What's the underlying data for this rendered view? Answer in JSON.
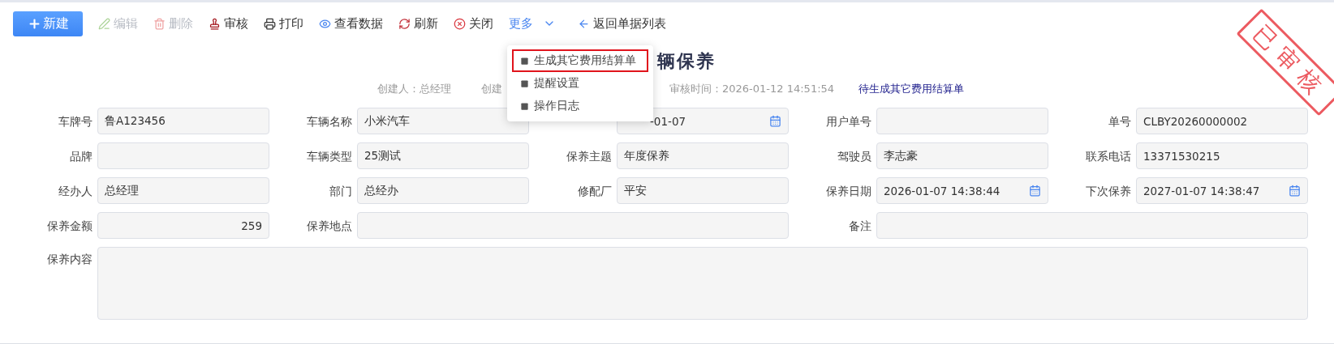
{
  "toolbar": [
    {
      "kind": "new",
      "label": "新建"
    },
    {
      "kind": "edit",
      "label": "编辑",
      "disabled": true
    },
    {
      "kind": "delete",
      "label": "删除",
      "disabled": true
    },
    {
      "kind": "audit",
      "label": "审核",
      "disabled": false
    },
    {
      "kind": "print",
      "label": "打印",
      "disabled": false
    },
    {
      "kind": "view",
      "label": "查看数据",
      "disabled": false
    },
    {
      "kind": "refresh",
      "label": "刷新",
      "disabled": false
    },
    {
      "kind": "close",
      "label": "关闭",
      "disabled": false
    },
    {
      "kind": "dropdown",
      "label": "更多",
      "expanded": true
    },
    {
      "kind": "back",
      "label": "返回单据列表",
      "disabled": false
    }
  ],
  "menu": [
    {
      "label": "生成其它费用结算单",
      "highlighted": true
    },
    {
      "label": "提醒设置",
      "highlighted": false
    },
    {
      "label": "操作日志",
      "highlighted": false
    }
  ],
  "title": "辆保养",
  "meta": [
    {
      "kind": "text",
      "text": "创建人：总经理"
    },
    {
      "kind": "text",
      "text": "创建"
    },
    {
      "kind": "text",
      "text": "审核时间：2026-01-12 14:51:54"
    },
    {
      "kind": "status",
      "text": "待生成其它费用结算单"
    }
  ],
  "stamp": "已审核",
  "fields": [
    {
      "label": "车牌号",
      "value": "鲁A123456",
      "kind": "text"
    },
    {
      "label": "车辆名称",
      "value": "小米汽车",
      "kind": "text"
    },
    {
      "value": "-01-07",
      "kind": "date"
    },
    {
      "label": "用户单号",
      "kind": "text"
    },
    {
      "label": "单号",
      "value": "CLBY20260000002",
      "kind": "text"
    },
    {
      "label": "品牌",
      "kind": "text"
    },
    {
      "label": "车辆类型",
      "value": "25测试",
      "kind": "text"
    },
    {
      "label": "保养主题",
      "value": "年度保养",
      "kind": "text"
    },
    {
      "label": "驾驶员",
      "value": "李志豪",
      "kind": "text"
    },
    {
      "label": "联系电话",
      "value": "13371530215",
      "kind": "text"
    },
    {
      "label": "经办人",
      "value": "总经理",
      "kind": "text"
    },
    {
      "label": "部门",
      "value": "总经办",
      "kind": "text"
    },
    {
      "label": "修配厂",
      "value": "平安",
      "kind": "text"
    },
    {
      "label": "保养日期",
      "value": "2026-01-07 14:38:44",
      "kind": "date"
    },
    {
      "label": "下次保养",
      "value": "2027-01-07 14:38:47",
      "kind": "date"
    },
    {
      "label": "保养金额",
      "value": "259",
      "kind": "number"
    },
    {
      "label": "保养地点",
      "kind": "wide"
    },
    {
      "label": "备注",
      "kind": "wide"
    },
    {
      "label": "保养内容",
      "kind": "area"
    }
  ]
}
